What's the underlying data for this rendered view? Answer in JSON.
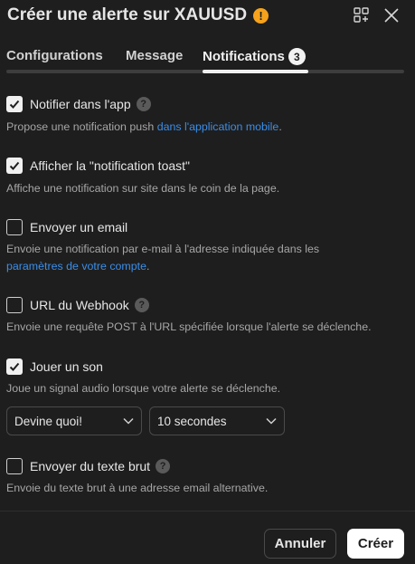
{
  "header": {
    "title": "Créer une alerte sur XAUUSD",
    "warning_glyph": "!"
  },
  "tabs": [
    {
      "label": "Configurations"
    },
    {
      "label": "Message"
    },
    {
      "label": "Notifications",
      "badge": "3"
    }
  ],
  "options": [
    {
      "title": "Notifier dans l'app",
      "checked": true,
      "desc_before": "Propose une notification push ",
      "desc_link": "dans l'application mobile",
      "desc_after": "."
    },
    {
      "title": "Afficher la \"notification toast\"",
      "checked": true,
      "desc": "Affiche une notification sur site dans le coin de la page."
    },
    {
      "title": "Envoyer un email",
      "checked": false,
      "desc_line1": "Envoie une notification par e-mail à l'adresse indiquée dans les",
      "desc_link": "paramètres de votre compte",
      "desc_after": "."
    },
    {
      "title": "URL du Webhook",
      "checked": false,
      "desc": "Envoie une requête POST à l'URL spécifiée lorsque l'alerte se déclenche."
    },
    {
      "title": "Jouer un son",
      "checked": true,
      "desc": "Joue un signal audio lorsque votre alerte se déclenche."
    },
    {
      "title": "Envoyer du texte brut",
      "checked": false,
      "desc": "Envoie du texte brut à une adresse email alternative."
    }
  ],
  "sound": {
    "tone_value": "Devine quoi!",
    "duration_value": "10 secondes"
  },
  "footer": {
    "cancel_label": "Annuler",
    "create_label": "Créer"
  },
  "colors": {
    "background": "#1e1e1e",
    "link": "#3b8ee8",
    "warning": "#f7a21b"
  }
}
